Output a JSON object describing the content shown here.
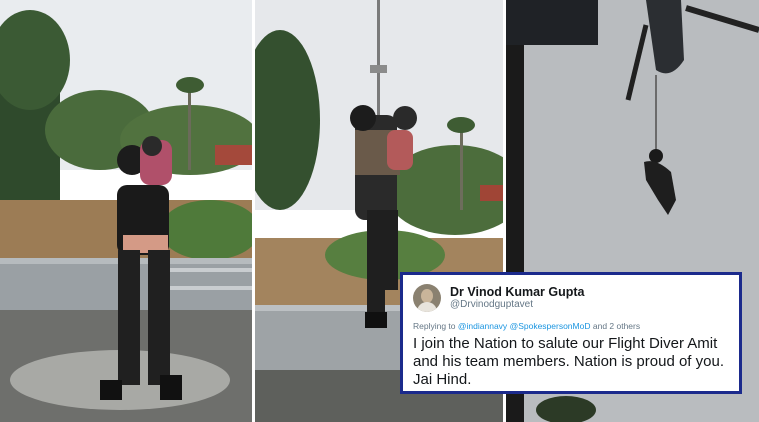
{
  "panels": [
    {
      "id": "panel-1",
      "description_icon": "rescue-girl-carrying-child-icon"
    },
    {
      "id": "panel-2",
      "description_icon": "rescue-winch-lift-icon"
    },
    {
      "id": "panel-3",
      "description_icon": "helicopter-rope-rescue-icon"
    }
  ],
  "tweet": {
    "name": "Dr Vinod Kumar Gupta",
    "handle": "@Drvinodguptavet",
    "reply_prefix": "Replying to",
    "reply_mention_1": "@indiannavy",
    "reply_mention_2": "@SpokespersonMoD",
    "reply_suffix": "and 2 others",
    "text": "I join the Nation to salute our Flight Diver Amit and his team members. Nation is proud of you. Jai Hind.",
    "border_color": "#1b2a8c",
    "mention_color": "#1b95e0"
  }
}
